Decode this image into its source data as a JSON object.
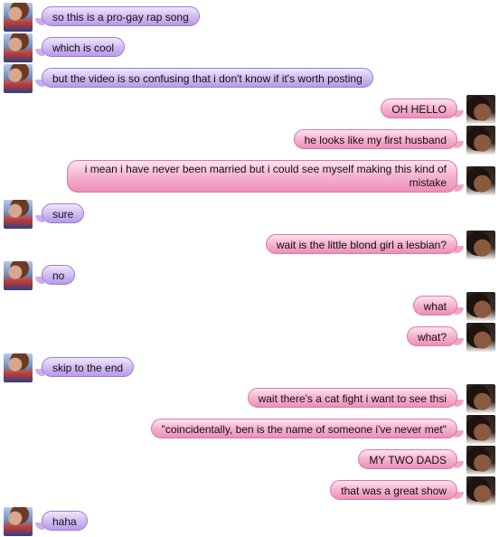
{
  "conversation": {
    "messages": [
      {
        "side": "left",
        "text": "so this is a pro-gay rap song"
      },
      {
        "side": "left",
        "text": "which is cool"
      },
      {
        "side": "left",
        "text": "but the video is so confusing that i don't know if it's worth posting"
      },
      {
        "side": "right",
        "text": "OH HELLO"
      },
      {
        "side": "right",
        "text": "he looks like my first husband"
      },
      {
        "side": "right",
        "text": "i mean i have never been married but i could see myself making this kind of mistake"
      },
      {
        "side": "left",
        "text": "sure"
      },
      {
        "side": "right",
        "text": "wait is the little blond girl a lesbian?"
      },
      {
        "side": "left",
        "text": "no"
      },
      {
        "side": "right",
        "text": "what"
      },
      {
        "side": "right",
        "text": "what?"
      },
      {
        "side": "left",
        "text": "skip to the end"
      },
      {
        "side": "right",
        "text": "wait there's a cat fight i want to see thsi"
      },
      {
        "side": "right",
        "text": "\"coincidentally, ben is the name of someone i've never met\""
      },
      {
        "side": "right",
        "text": "MY TWO DADS"
      },
      {
        "side": "right",
        "text": "that was a great show"
      },
      {
        "side": "left",
        "text": "haha"
      }
    ]
  }
}
